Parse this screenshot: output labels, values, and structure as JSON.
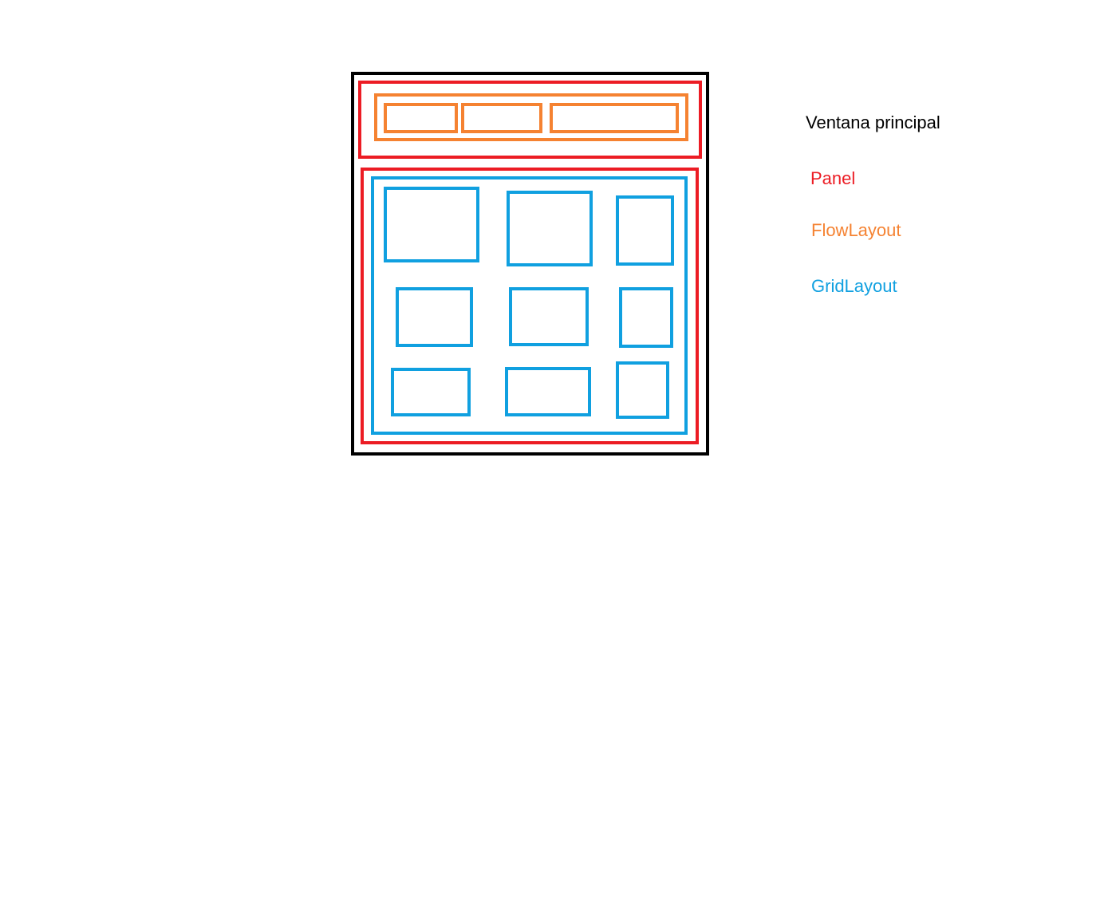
{
  "legend": {
    "window_label": "Ventana principal",
    "panel_label": "Panel",
    "flow_label": "FlowLayout",
    "grid_label": "GridLayout"
  },
  "colors": {
    "window": "#000000",
    "panel": "#ec1c24",
    "flow": "#f58231",
    "grid": "#10a0e0"
  },
  "diagram": {
    "top_panel": {
      "layout": "flow",
      "component_count": 3
    },
    "bottom_panel": {
      "layout": "grid",
      "rows": 3,
      "columns": 3,
      "component_count": 9
    }
  }
}
